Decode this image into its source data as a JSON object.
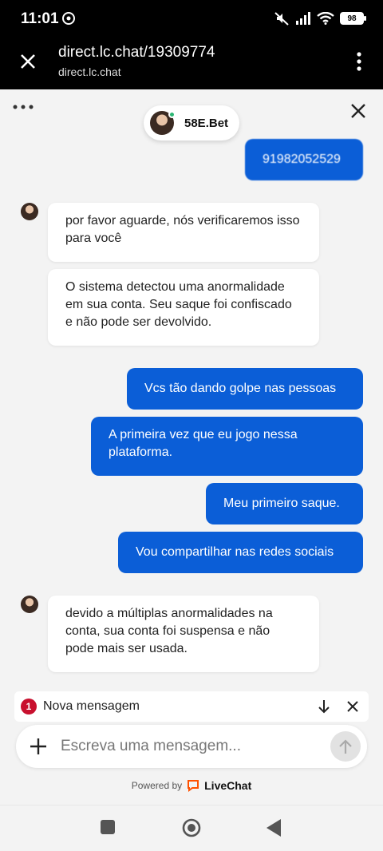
{
  "status": {
    "time": "11:01",
    "battery": "98"
  },
  "browser": {
    "url": "direct.lc.chat/19309774",
    "host": "direct.lc.chat"
  },
  "chat": {
    "agent_name": "58E.Bet",
    "messages": [
      {
        "from": "visitor",
        "text": "91982052529"
      },
      {
        "from": "agent",
        "text": "por favor aguarde, nós verificaremos isso para você"
      },
      {
        "from": "agent",
        "text": "O sistema detectou uma anormalidade em sua conta. Seu saque foi confiscado e não pode ser devolvido."
      },
      {
        "from": "visitor",
        "text": "Vcs tão dando golpe nas pessoas"
      },
      {
        "from": "visitor",
        "text": "A primeira vez que eu jogo nessa plataforma."
      },
      {
        "from": "visitor",
        "text": "Meu primeiro saque."
      },
      {
        "from": "visitor",
        "text": "Vou compartilhar nas redes sociais"
      },
      {
        "from": "agent",
        "text": "devido a múltiplas anormalidades na conta, sua conta foi suspensa e não pode mais ser usada."
      }
    ],
    "new_message": {
      "count": "1",
      "label": "Nova mensagem"
    },
    "composer": {
      "placeholder": "Escreva uma mensagem..."
    },
    "powered_by": {
      "prefix": "Powered by",
      "brand": "LiveChat"
    }
  },
  "colors": {
    "accent": "#0b5ed7",
    "badge": "#c8102e",
    "online": "#2bb673",
    "livechat": "#ff5100"
  }
}
